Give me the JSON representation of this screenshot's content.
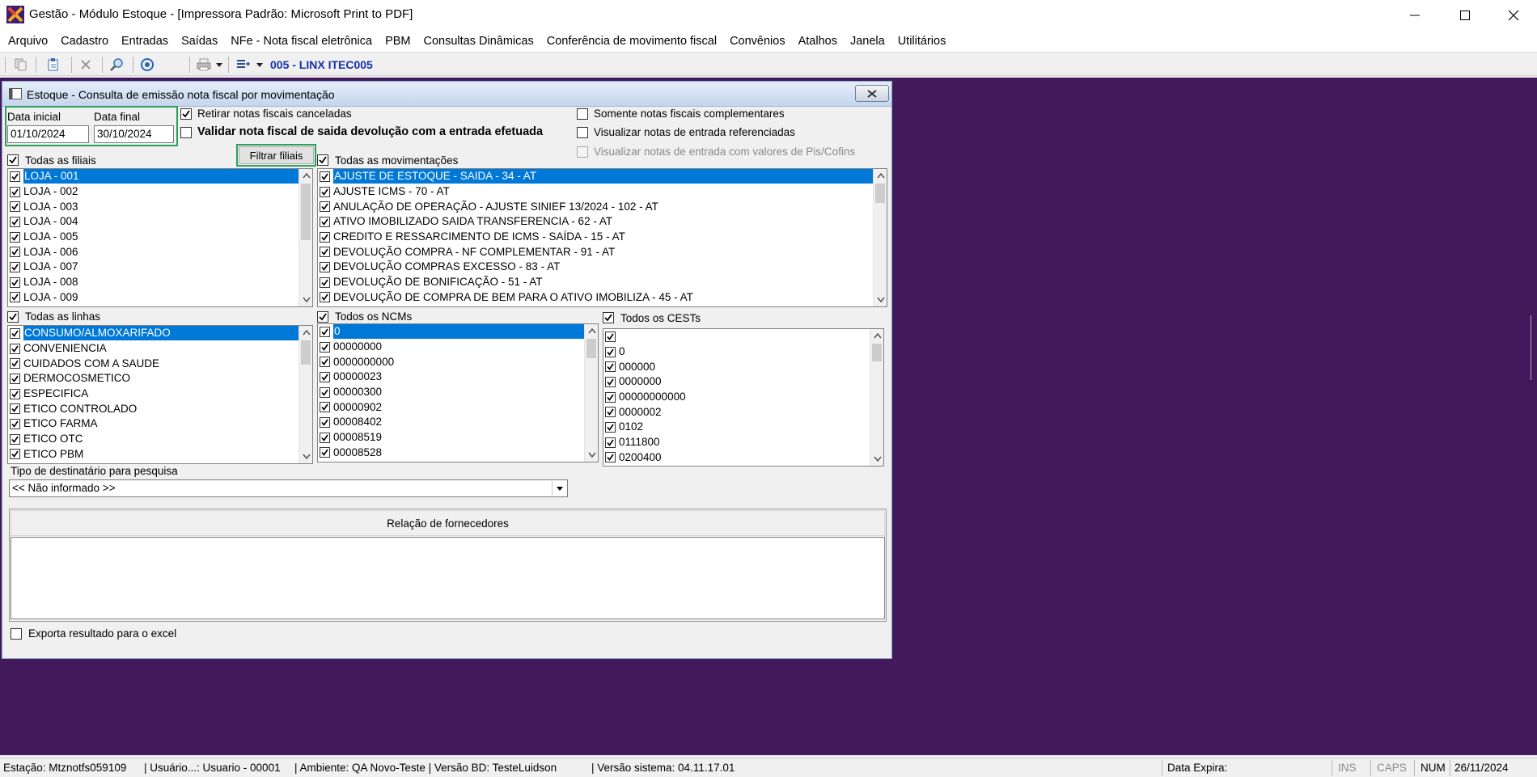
{
  "window": {
    "title": "Gestão  - Módulo Estoque - [Impressora Padrão: Microsoft Print to PDF]"
  },
  "menu": [
    "Arquivo",
    "Cadastro",
    "Entradas",
    "Saídas",
    "NFe - Nota fiscal eletrônica",
    "PBM",
    "Consultas Dinâmicas",
    "Conferência de movimento fiscal",
    "Convênios",
    "Atalhos",
    "Janela",
    "Utilitários"
  ],
  "toolbar": {
    "label": "005 - LINX ITEC005"
  },
  "dialog": {
    "title": "Estoque - Consulta de emissão nota fiscal por movimentação",
    "data_inicial_label": "Data inicial",
    "data_inicial": "01/10/2024",
    "data_final_label": "Data final",
    "data_final": "30/10/2024",
    "retirar_canceladas": "Retirar notas fiscais canceladas",
    "validar_devolucao": "Validar nota fiscal de saida devolução com a entrada efetuada",
    "somente_complementares": "Somente notas fiscais complementares",
    "visualizar_referenciadas": "Visualizar notas de entrada referenciadas",
    "visualizar_pis_cofins": "Visualizar notas de entrada com valores de Pis/Cofins",
    "filtrar_filiais": "Filtrar filiais",
    "todas_filiais": "Todas as filiais",
    "filiais": [
      "LOJA - 001",
      "LOJA - 002",
      "LOJA - 003",
      "LOJA - 004",
      "LOJA - 005",
      "LOJA - 006",
      "LOJA - 007",
      "LOJA - 008",
      "LOJA - 009"
    ],
    "todas_movimentacoes": "Todas as movimentações",
    "movimentacoes": [
      "AJUSTE DE ESTOQUE - SAIDA - 34 - AT",
      "AJUSTE ICMS - 70 - AT",
      "ANULAÇÃO DE OPERAÇÃO - AJUSTE SINIEF 13/2024 - 102 - AT",
      "ATIVO IMOBILIZADO SAIDA TRANSFERENCIA - 62 - AT",
      "CREDITO E RESSARCIMENTO DE ICMS - SAÍDA - 15 - AT",
      "DEVOLUÇÃO COMPRA - NF COMPLEMENTAR - 91 - AT",
      "DEVOLUÇÃO COMPRAS EXCESSO - 83 - AT",
      "DEVOLUÇÃO DE BONIFICAÇÃO - 51 - AT",
      "DEVOLUÇÃO DE COMPRA DE BEM PARA O ATIVO IMOBILIZA - 45 - AT"
    ],
    "todas_linhas": "Todas as linhas",
    "linhas": [
      "CONSUMO/ALMOXARIFADO",
      "CONVENIENCIA",
      "CUIDADOS COM A SAUDE",
      "DERMOCOSMETICO",
      "ESPECIFICA",
      "ETICO CONTROLADO",
      "ETICO FARMA",
      "ETICO OTC",
      "ETICO PBM"
    ],
    "todos_ncms": "Todos os NCMs",
    "ncms": [
      "0",
      "00000000",
      "0000000000",
      "00000023",
      "00000300",
      "00000902",
      "00008402",
      "00008519",
      "00008528"
    ],
    "todos_cests": "Todos os CESTs",
    "cests": [
      "",
      "0",
      "000000",
      "0000000",
      "00000000000",
      "0000002",
      "0102",
      "0111800",
      "0200400"
    ],
    "tipo_destinatario_label": "Tipo de destinatário para pesquisa",
    "tipo_destinatario": "<< Não informado >>",
    "relacao_fornecedores": "Relação de fornecedores",
    "exporta_excel": "Exporta resultado para o excel"
  },
  "status": {
    "estacao": "Estação: Mtznotfs059109",
    "usuario": "| Usuário...: Usuario - 00001",
    "ambiente": "| Ambiente: QA Novo-Teste | Versão BD: TesteLuidson",
    "versao": "| Versão sistema: 04.11.17.01",
    "data_expira": "Data Expira:",
    "ins": "INS",
    "caps": "CAPS",
    "num": "NUM",
    "data": "26/11/2024"
  }
}
